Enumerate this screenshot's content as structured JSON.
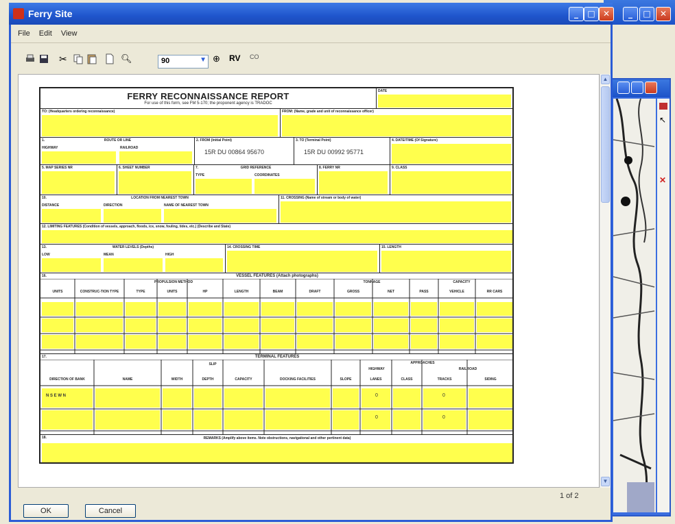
{
  "window": {
    "title": "Ferry Site",
    "minimize": "_",
    "maximize": "□",
    "close": "✕"
  },
  "menu": [
    "File",
    "Edit",
    "View"
  ],
  "toolbar": {
    "zoom_value": "90",
    "rv_label": "RV",
    "co_label": "CO"
  },
  "form": {
    "title": "FERRY RECONNAISSANCE REPORT",
    "subtitle": "For use of this form, see FM 5-170; the proponent agency is TRADOC",
    "date_label": "DATE",
    "to_label": "TO: (Headquarters ordering reconnaissance)",
    "from_label": "FROM: (Name, grade and unit of reconnaissance officer)",
    "route_label": "ROUTE OR LINE",
    "highway_label": "HIGHWAY",
    "railroad_label": "RAILROAD",
    "from_ferry_label": "2. FROM (Initial Point)",
    "from_ferry_value": "15R DU 00864 95670",
    "to_ferry_label": "3. TO (Terminal Point)",
    "to_ferry_value": "15R DU 00992 95771",
    "datetime_label": "4. DATE/TIME (Of Signature)",
    "map_series_label": "5. MAP SERIES NR",
    "sheet_label": "6. SHEET NUMBER",
    "grid_label": "GRID REFERENCE",
    "type_label": "TYPE",
    "coords_label": "COORDINATES",
    "ferry_nr_label": "8. FERRY NR",
    "class_label": "9. CLASS",
    "location_label": "LOCATION FROM NEAREST TOWN",
    "distance_label": "DISTANCE",
    "direction_label": "DIRECTION",
    "town_label": "NAME OF NEAREST TOWN",
    "crossing_label": "11. CROSSING (Name of stream or body of water)",
    "limiting_label": "12. LIMITING FEATURES (Condition of vessels, approach, floods, ice, snow, fouling, tides, etc.) (Describe and State)",
    "water_label": "WATER LEVELS (Depths)",
    "low_label": "LOW",
    "mean_label": "MEAN",
    "high_label": "HIGH",
    "crossing_time_label": "14. CROSSING TIME",
    "length_label": "15. LENGTH",
    "vessel_title": "VESSEL FEATURES (Attach photographs)",
    "vessel_cols": [
      "UNITS",
      "CONSTRUC-TION TYPE",
      "TYPE",
      "UNITS",
      "HP",
      "LENGTH",
      "BEAM",
      "DRAFT",
      "GROSS",
      "NET",
      "PASS",
      "VEHICLE",
      "RR CARS"
    ],
    "propulsion_label": "PROPULSION METHOD",
    "tonnage_label": "TONNAGE",
    "capacity_label": "CAPACITY",
    "terminal_title": "TERMINAL FEATURES",
    "terminal_cols": [
      "DIRECTION OF BANK",
      "NAME",
      "WIDTH",
      "DEPTH",
      "CAPACITY",
      "DOCKING FACILITIES",
      "SLOPE",
      "LANES",
      "CLASS",
      "TRACKS",
      "SIDING"
    ],
    "slip_label": "SLIP",
    "approaches_label": "APPROACHES",
    "highway_app_label": "HIGHWAY",
    "railroad_app_label": "RAILROAD",
    "bank_value": "N S E W N",
    "lane_zero": "0",
    "remarks_label": "REMARKS (Amplify above items. Note obstructions, navigational and other pertinent data)",
    "num_1": "1.",
    "num_10": "10.",
    "num_13": "13.",
    "num_16": "16.",
    "num_17": "17.",
    "num_18": "18.",
    "num_7": "7."
  },
  "page_indicator": "1 of 2",
  "buttons": {
    "ok": "OK",
    "cancel": "Cancel"
  }
}
